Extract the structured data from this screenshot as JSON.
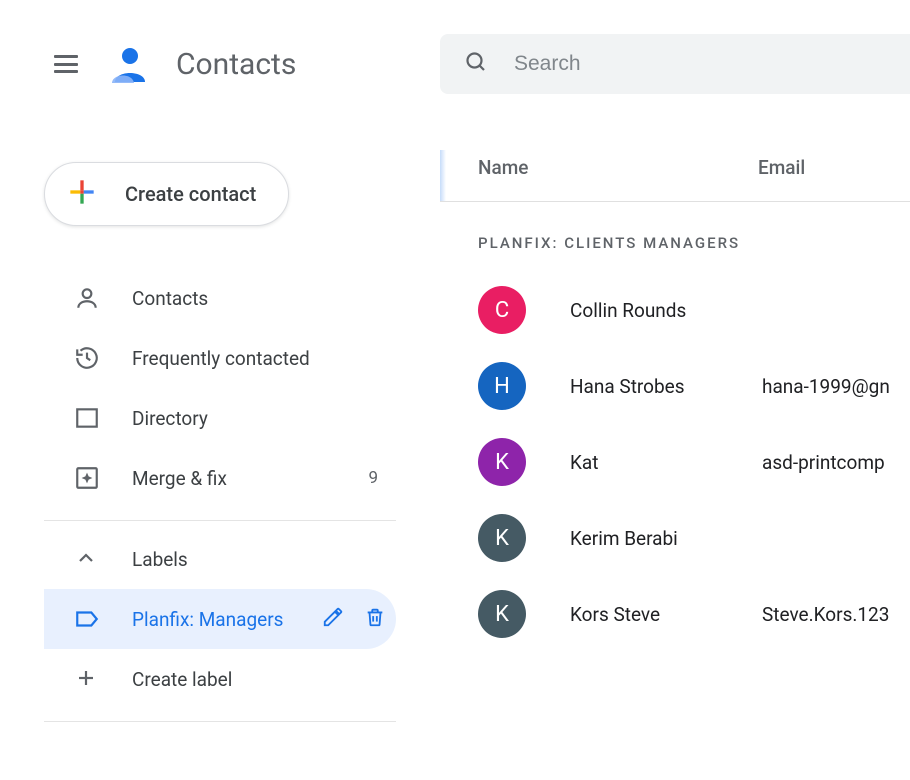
{
  "header": {
    "title": "Contacts",
    "search_placeholder": "Search"
  },
  "sidebar": {
    "create_label": "Create contact",
    "nav": [
      {
        "id": "contacts",
        "label": "Contacts"
      },
      {
        "id": "frequent",
        "label": "Frequently contacted"
      },
      {
        "id": "directory",
        "label": "Directory"
      },
      {
        "id": "merge",
        "label": "Merge & fix",
        "badge": "9"
      }
    ],
    "labels_heading": "Labels",
    "labels": [
      {
        "id": "planfix-managers",
        "label": "Planfix: Managers",
        "selected": true
      }
    ],
    "create_label_text": "Create label"
  },
  "main": {
    "columns": {
      "name": "Name",
      "email": "Email"
    },
    "section_title": "PLANFIX: CLIENTS MANAGERS",
    "contacts": [
      {
        "initial": "C",
        "color": "#e91e63",
        "name": "Collin Rounds",
        "email": ""
      },
      {
        "initial": "H",
        "color": "#1565c0",
        "name": "Hana Strobes",
        "email": "hana-1999@gn"
      },
      {
        "initial": "K",
        "color": "#8e24aa",
        "name": "Kat",
        "email": "asd-printcomp"
      },
      {
        "initial": "K",
        "color": "#455a64",
        "name": "Kerim Berabi",
        "email": ""
      },
      {
        "initial": "K",
        "color": "#455a64",
        "name": "Kors Steve",
        "email": "Steve.Kors.123"
      }
    ]
  }
}
